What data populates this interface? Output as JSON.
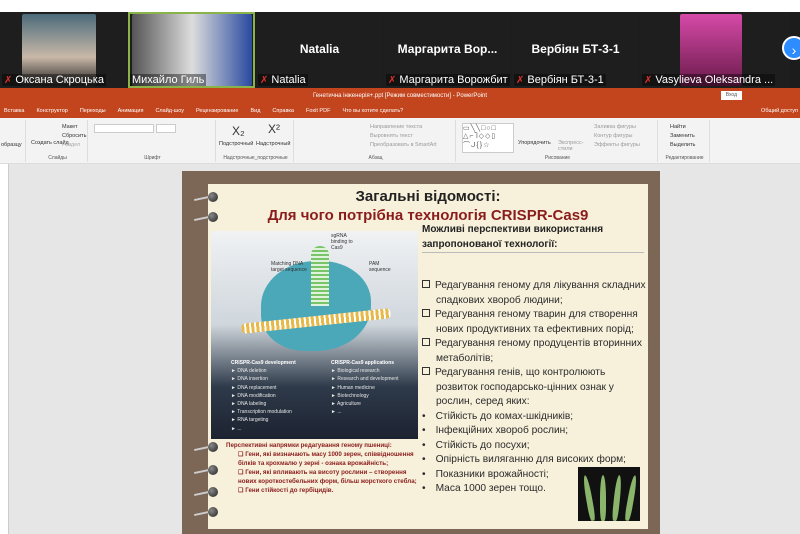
{
  "participants": [
    {
      "name": "Оксана Скроцька",
      "video": true
    },
    {
      "name": "Михайло Гиль",
      "video": true,
      "active": true
    },
    {
      "name": "Natalia",
      "display": "Natalia"
    },
    {
      "name": "Маргарита Ворожбит",
      "display": "Маргарита  Вор..."
    },
    {
      "name": "Вербіян БТ-3-1",
      "display": "Вербіян БТ-3-1"
    },
    {
      "name": "Vasylieva Oleksandra ...",
      "video": true
    }
  ],
  "app": {
    "title": "Генетична інженерія+.ppt [Режим совместимости] - PowerPoint",
    "signin": "Вход",
    "share": "Общий доступ",
    "tabs": [
      "Вставка",
      "Конструктор",
      "Переходы",
      "Анимация",
      "Слайд-шоу",
      "Рецензирование",
      "Вид",
      "Справка",
      "Foxit PDF",
      "Что вы хотите сделать?"
    ]
  },
  "ribbon": {
    "slides_group": "Слайды",
    "font_group": "Шрифт",
    "sub_group": "Надстрочные_подстрочные",
    "para_group": "Абзац",
    "draw_group": "Рисование",
    "edit_group": "Редактирование",
    "create_slide": "Создать слайд",
    "layout": "Макет",
    "reset": "Сбросить",
    "section": "Раздел",
    "sample": "образцу",
    "subscript": "Подстрочный",
    "superscript": "Надстрочный",
    "text_dir": "Направление текста",
    "align_text": "Выровнять текст",
    "smartart": "Преобразовать в SmartArt",
    "arrange": "Упорядочить",
    "quick_styles": "Экспресс-стили",
    "fill": "Заливка фигуры",
    "outline": "Контур фигуры",
    "effects": "Эффекты фигуры",
    "find": "Найти",
    "replace": "Заменить",
    "select": "Выделить"
  },
  "slide": {
    "title1": "Загальні відомості:",
    "title2": "Для чого потрібна технологія CRISPR-Cas9",
    "image": {
      "sgrna": "sgRNA binding to Cas9",
      "pam": "PAM sequence",
      "matching": "Matching DNA target sequence",
      "dev_title": "CRISPR-Cas9 development",
      "dev": [
        "DNA deletion",
        "DNA insertion",
        "DNA replacement",
        "DNA modification",
        "DNA labeling",
        "Transcription modulation",
        "RNA targeting",
        "..."
      ],
      "app_title": "CRISPR-Cas9 applications",
      "apps": [
        "Biological research",
        "Research and development",
        "Human medicine",
        "Biotechnology",
        "Agriculture",
        "..."
      ]
    },
    "perspectives_heading": "Можливі перспективи використання запропонованої технології:",
    "items": [
      {
        "type": "box",
        "text": "Редагування геному для лікування складних спадкових хвороб людини;"
      },
      {
        "type": "box",
        "text": "Редагування геному тварин для створення нових продуктивних та ефективних порід;"
      },
      {
        "type": "box",
        "text": "Редагування геному продуцентів вторинних метаболітів;"
      },
      {
        "type": "box",
        "text": "Редагування генів, що контролюють розвиток господарсько-цінних ознак у рослин, серед яких:"
      },
      {
        "type": "bullet",
        "text": "Стійкість до комах-шкідників;"
      },
      {
        "type": "bullet",
        "text": "Інфекційних хвороб рослин;"
      },
      {
        "type": "bullet",
        "text": "Стійкість до посухи;"
      },
      {
        "type": "bullet",
        "text": "Опірність виляганню для високих форм;"
      },
      {
        "type": "bullet",
        "text": "Показники врожайності;"
      },
      {
        "type": "bullet",
        "text": "Маса 1000 зерен тощо."
      }
    ],
    "wheat_heading": "Перспективні напрямки редагування геному пшениці:",
    "wheat_items": [
      "Гени, які визначають масу 1000 зерен, співвідношення білків та крохмалю у зерні - ознака врожайність;",
      "Гени, які впливають на висоту рослини – створення нових короткостебельних форм, більш жорсткого стебла;",
      "Гени стійкості до гербіцидів."
    ]
  }
}
